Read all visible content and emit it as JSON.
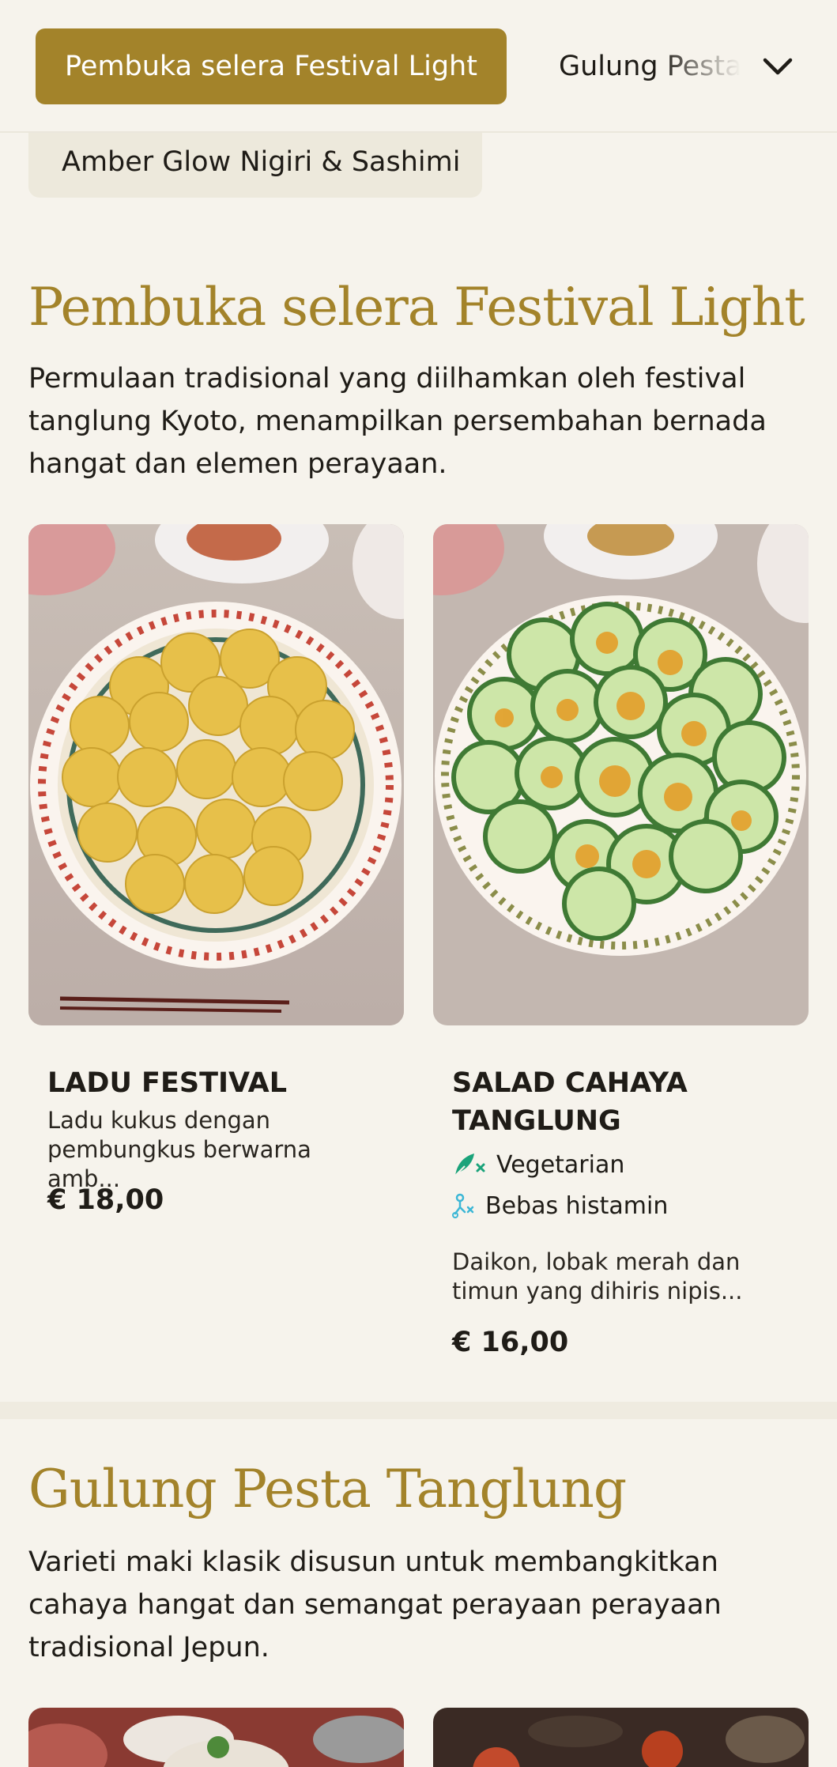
{
  "category_nav": {
    "active_label": "Pembuka selera Festival Light",
    "next_label": "Gulung Pesta Tanglung",
    "previous_label": "Amber Glow Nigiri & Sashimi",
    "expand_icon": "chevron-down-icon"
  },
  "sections": [
    {
      "title": "Pembuka selera Festival Light",
      "description": "Permulaan tradisional yang diilhamkan oleh festival tanglung Kyoto, menampilkan persembahan bernada hangat dan elemen perayaan.",
      "items": [
        {
          "name": "LADU FESTIVAL",
          "description": "Ladu kukus dengan pembungkus berwarna amb...",
          "price": "€ 18,00",
          "tags": []
        },
        {
          "name": "SALAD CAHAYA TANGLUNG",
          "description": "Daikon, lobak merah dan timun yang dihiris nipis...",
          "price": "€ 16,00",
          "tags": [
            {
              "label": "Vegetarian",
              "icon": "vegetarian-icon",
              "color": "#1aa37a"
            },
            {
              "label": "Bebas histamin",
              "icon": "histamine-free-icon",
              "color": "#3cb7d6"
            }
          ]
        }
      ]
    },
    {
      "title": "Gulung Pesta Tanglung",
      "description": "Varieti maki klasik disusun untuk membangkitkan cahaya hangat dan semangat perayaan perayaan tradisional Jepun."
    }
  ],
  "colors": {
    "accent": "#a3832a",
    "background": "#f6f3ec",
    "chip": "#ede9dc",
    "text": "#1f1c17"
  }
}
